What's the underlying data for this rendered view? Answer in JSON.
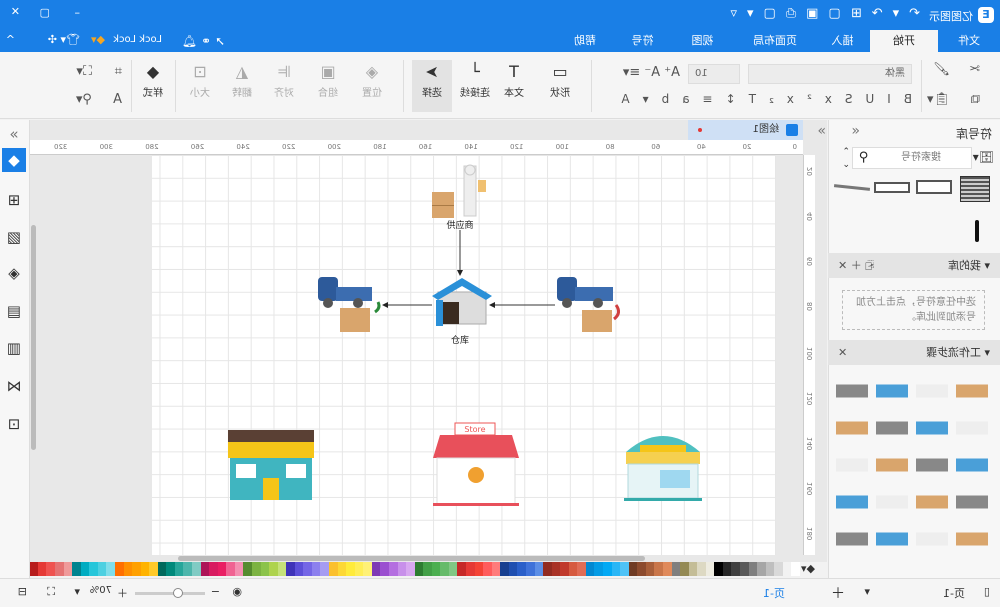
{
  "app": {
    "title": "亿图图示",
    "account": "Lock Lock"
  },
  "menu": {
    "tabs": [
      "文件",
      "开始",
      "插入",
      "页面布局",
      "视图",
      "符号",
      "帮助"
    ],
    "active": "开始"
  },
  "toolbar": {
    "font_family": "黑体",
    "font_size": "10",
    "shape": "形状",
    "text": "文本",
    "connector": "连接线",
    "select": "选择",
    "position": "位置",
    "group": "组合",
    "align": "对齐",
    "flip": "翻转",
    "size": "大小",
    "style": "样式"
  },
  "library": {
    "title": "符号库",
    "search_placeholder": "搜索符号",
    "my_library": "我的库",
    "my_library_hint": "选中任意符号，点击上方加号添加到此库。",
    "workflow": "工作流步骤"
  },
  "document": {
    "tab": "绘图1",
    "ruler_h": [
      "0",
      "20",
      "40",
      "60",
      "80",
      "100",
      "120",
      "140",
      "160",
      "180",
      "200",
      "220",
      "240",
      "260",
      "280",
      "300",
      "320"
    ],
    "ruler_v": [
      "20",
      "40",
      "60",
      "80",
      "100",
      "120",
      "140",
      "160",
      "180"
    ]
  },
  "diagram": {
    "supplier": "供应商",
    "warehouse": "仓库",
    "store_sign": "Store"
  },
  "status": {
    "page_tab": "页-1",
    "page_current": "页-1",
    "zoom": "70%"
  },
  "colors": {
    "accent": "#1a7fe6",
    "palette": [
      "#ffffff",
      "#f2f2f2",
      "#d9d9d9",
      "#bfbfbf",
      "#a6a6a6",
      "#7f7f7f",
      "#595959",
      "#404040",
      "#262626",
      "#000000",
      "#eeece1",
      "#ddd9c3",
      "#c4bd97",
      "#948a54",
      "#7f7f7f",
      "#e08a5b",
      "#c9764a",
      "#a85f3a",
      "#8c4b2e",
      "#6f3b24",
      "#4fc3f7",
      "#29b6f6",
      "#03a9f4",
      "#039be5",
      "#0288d1",
      "#e06c55",
      "#d65a3f",
      "#c0392b",
      "#a93226",
      "#922b21",
      "#5c8ee6",
      "#3f72d9",
      "#2a5fc9",
      "#1f4fb0",
      "#173f90",
      "#ff7b7b",
      "#ff5c5c",
      "#f44336",
      "#e53935",
      "#c62828",
      "#81c784",
      "#66bb6a",
      "#4caf50",
      "#43a047",
      "#2e7d32",
      "#d8a8f0",
      "#c890ea",
      "#b46ee0",
      "#9b4fd0",
      "#7e3ab5",
      "#fff176",
      "#ffee58",
      "#ffeb3b",
      "#fdd835",
      "#fbc02d",
      "#a59cf2",
      "#8c80ee",
      "#7466e6",
      "#5c4fd8",
      "#3f33b8",
      "#c5e17a",
      "#aed34e",
      "#8bc34a",
      "#7cb342",
      "#558b2f",
      "#f48fb1",
      "#f06292",
      "#e91e63",
      "#d81b60",
      "#ad1457",
      "#80cbc4",
      "#4db6ac",
      "#26a69a",
      "#00897b",
      "#00695c",
      "#ffca28",
      "#ffb300",
      "#ffa000",
      "#ff8f00",
      "#ff6f00",
      "#80deea",
      "#4dd0e1",
      "#26c6da",
      "#00acc1",
      "#00838f",
      "#ef9a9a",
      "#e57373",
      "#ef5350",
      "#e53935",
      "#b71c1c"
    ]
  }
}
